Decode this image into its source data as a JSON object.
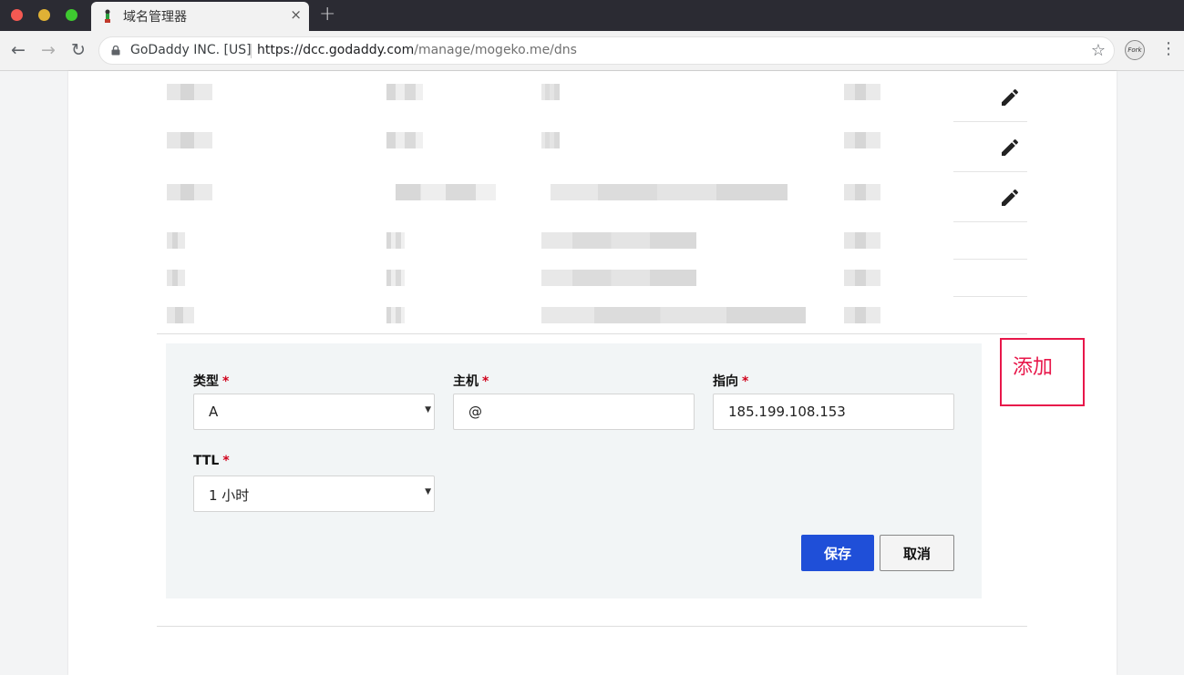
{
  "browser": {
    "tab_title": "域名管理器",
    "tab_close_icon": "×",
    "new_tab_icon": "+",
    "back_icon": "←",
    "forward_icon": "→",
    "reload_icon": "↻",
    "site_org": "GoDaddy INC. [US]",
    "url_scheme": "https://",
    "url_host": "dcc.godaddy.com",
    "url_path": "/manage/mogeko.me/dns",
    "bookmark_icon": "☆",
    "profile_text": "Fork",
    "menu_icon": "⋮"
  },
  "form": {
    "type_label": "类型",
    "host_label": "主机",
    "points_to_label": "指向",
    "ttl_label": "TTL",
    "required_mark": "*",
    "type_value": "A",
    "host_value": "@",
    "points_to_value": "185.199.108.153",
    "ttl_value": "1 小时",
    "select_arrow": "▼",
    "save_label": "保存",
    "cancel_label": "取消"
  },
  "annotation": {
    "text": "添加",
    "color": "#e8174a"
  },
  "colors": {
    "primary_button": "#1f4fd8",
    "required": "#d0021b"
  },
  "icons": {
    "edit": "pencil-icon"
  }
}
